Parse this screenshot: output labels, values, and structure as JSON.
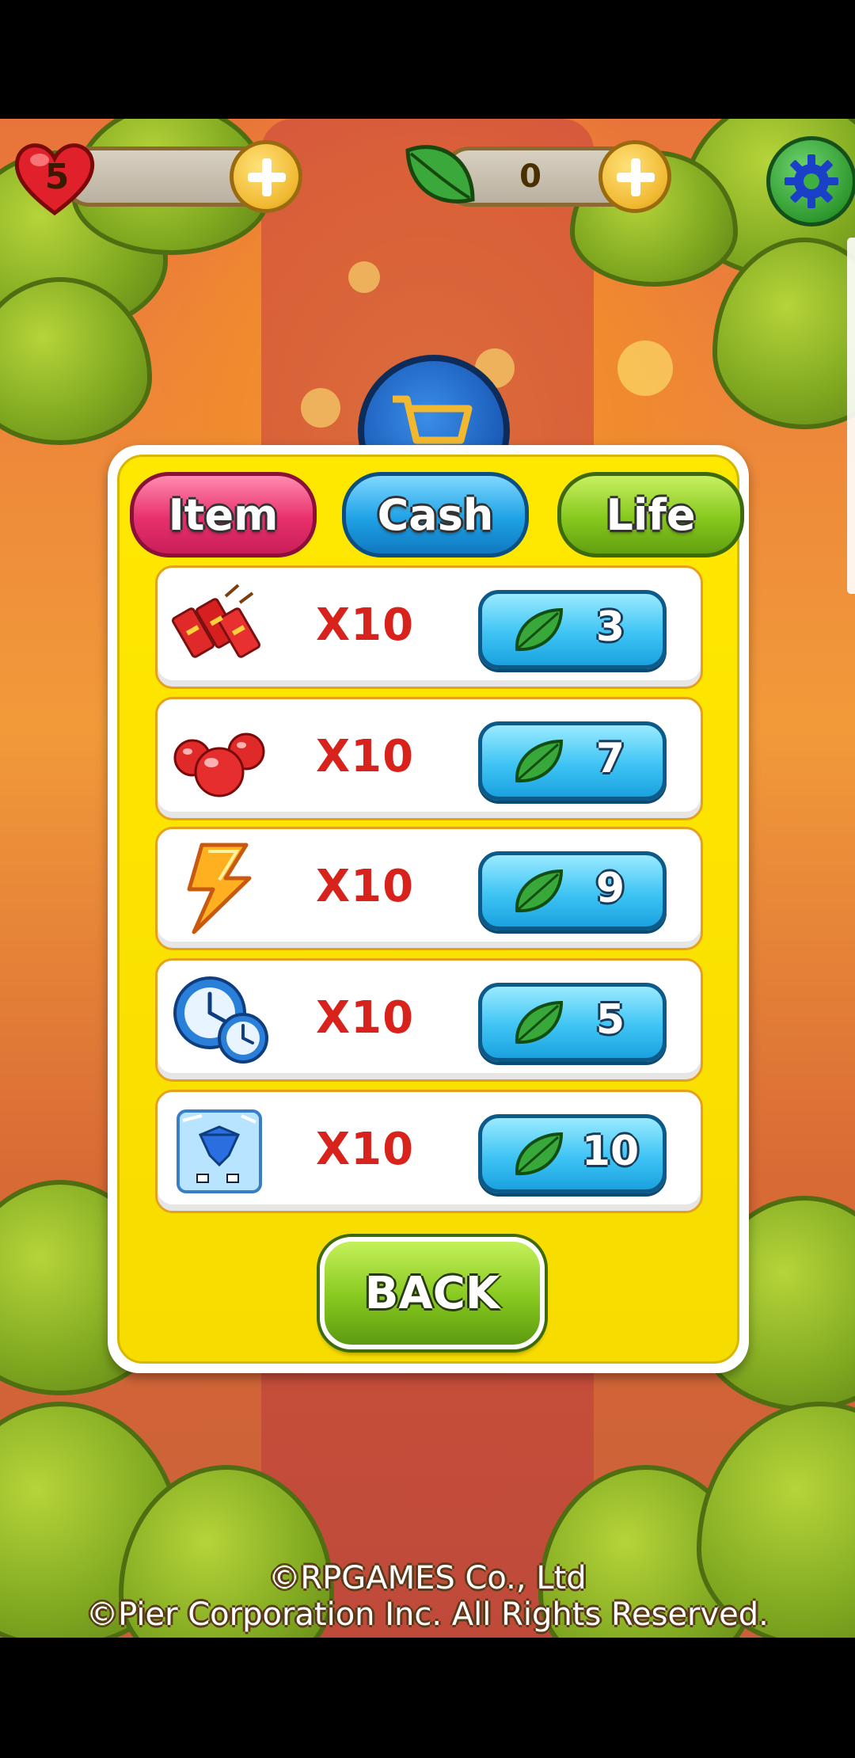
{
  "top_bar": {
    "lives": "5",
    "leaves": "0"
  },
  "tabs": [
    {
      "label": "Item"
    },
    {
      "label": "Cash"
    },
    {
      "label": "Life"
    }
  ],
  "items": [
    {
      "icon": "firecracker-icon",
      "qty": "X10",
      "price": "3"
    },
    {
      "icon": "red-balls-icon",
      "qty": "X10",
      "price": "7"
    },
    {
      "icon": "lightning-icon",
      "qty": "X10",
      "price": "9"
    },
    {
      "icon": "clock-icon",
      "qty": "X10",
      "price": "5"
    },
    {
      "icon": "ice-block-icon",
      "qty": "X10",
      "price": "10"
    }
  ],
  "back_label": "BACK",
  "footer": {
    "line1": "©RPGAMES Co., Ltd",
    "line2": "©Pier Corporation Inc. All Rights Reserved."
  },
  "colors": {
    "modal_fill": "#ffe800",
    "tab_item": "#e8306c",
    "tab_cash": "#1ea2e6",
    "tab_life": "#86c81e",
    "qty_text": "#d8221c",
    "buy_button": "#3ec4f4"
  }
}
